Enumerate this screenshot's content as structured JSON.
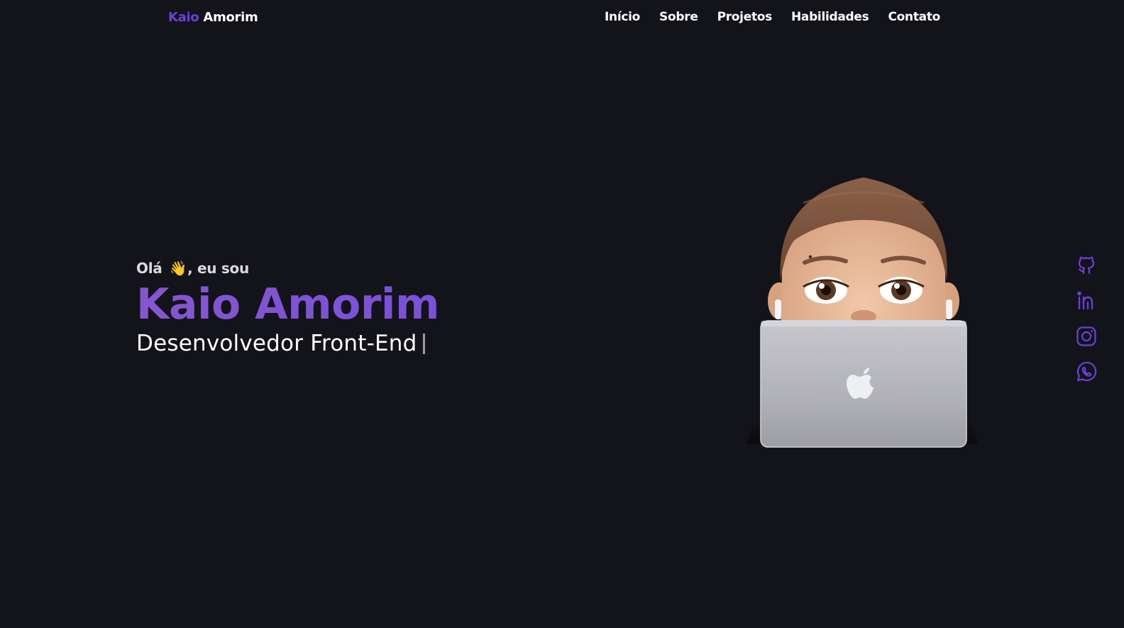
{
  "header": {
    "logo_first": "Kaio",
    "logo_last": "Amorim",
    "nav": [
      "Início",
      "Sobre",
      "Projetos",
      "Habilidades",
      "Contato"
    ]
  },
  "hero": {
    "greeting_before": "Olá",
    "greeting_emoji": "👋",
    "greeting_after": ", eu sou",
    "name": "Kaio Amorim",
    "role": "Desenvolvedor Front-End"
  },
  "avatar": {
    "icon": "memoji-avatar-with-laptop"
  },
  "social": [
    "github-icon",
    "linkedin-icon",
    "instagram-icon",
    "whatsapp-icon"
  ],
  "colors": {
    "background": "#13131a",
    "accent": "#6a40d8",
    "gradient_start": "#8656cf",
    "gradient_end": "#7b50d9",
    "text": "#ffffff"
  }
}
